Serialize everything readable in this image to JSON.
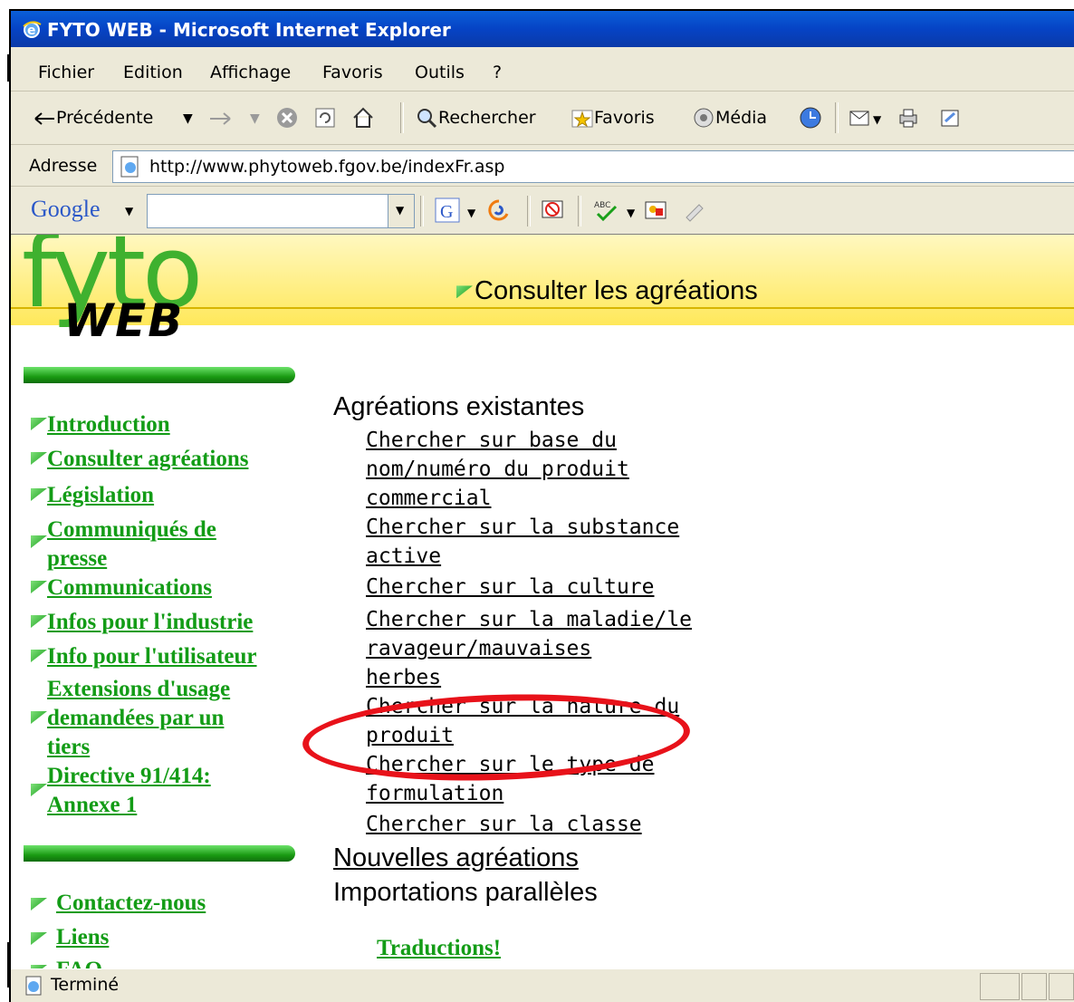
{
  "window": {
    "title": "FYTO WEB - Microsoft Internet Explorer"
  },
  "menu": [
    "Fichier",
    "Edition",
    "Affichage",
    "Favoris",
    "Outils",
    "?"
  ],
  "toolbar": {
    "back": "Précédente",
    "search": "Rechercher",
    "favorites": "Favoris",
    "media": "Média"
  },
  "address": {
    "label": "Adresse",
    "url": "http://www.phytoweb.fgov.be/indexFr.asp"
  },
  "google": {
    "logo": "Google",
    "search_value": ""
  },
  "page": {
    "logo_top": "fyto",
    "logo_bottom": "WEB",
    "heading": "Consulter les agréations",
    "nav": {
      "introduction": "Introduction",
      "consulter": "Consulter agréations",
      "legislation": "Législation",
      "communiques_1": "Communiqués de",
      "communiques_2": "presse",
      "communications": "Communications",
      "infos_industrie": "Infos pour l'industrie",
      "info_utilisateur": "Info pour l'utilisateur",
      "extensions_1": "Extensions d'usage",
      "extensions_2": "demandées par un",
      "extensions_3": "tiers",
      "directive_1": "Directive 91/414:",
      "directive_2": "Annexe 1",
      "contact": "Contactez-nous",
      "liens": "Liens",
      "faq": "FAQ"
    },
    "sections": {
      "existing": "Agréations existantes",
      "new": "Nouvelles agréations",
      "parallel": "Importations parallèles",
      "translations": "Traductions!"
    },
    "links": {
      "produit_1": "Chercher sur base du",
      "produit_2": "nom/numéro du produit",
      "produit_3": "commercial",
      "substance_1": "Chercher sur la substance",
      "substance_2": "active",
      "culture": "Chercher sur la culture",
      "maladie_1": "Chercher sur la maladie/le",
      "maladie_2": "ravageur/mauvaises",
      "maladie_3": "herbes",
      "nature_1": "Chercher sur la nature du",
      "nature_2": "produit",
      "formulation_1": "Chercher sur le type de",
      "formulation_2": "formulation",
      "classe": "Chercher sur la classe"
    }
  },
  "status": {
    "text": "Terminé"
  },
  "colors": {
    "nav_green": "#139c16",
    "annotation_red": "#e8121a",
    "banner_yellow": "#ffe85a"
  }
}
